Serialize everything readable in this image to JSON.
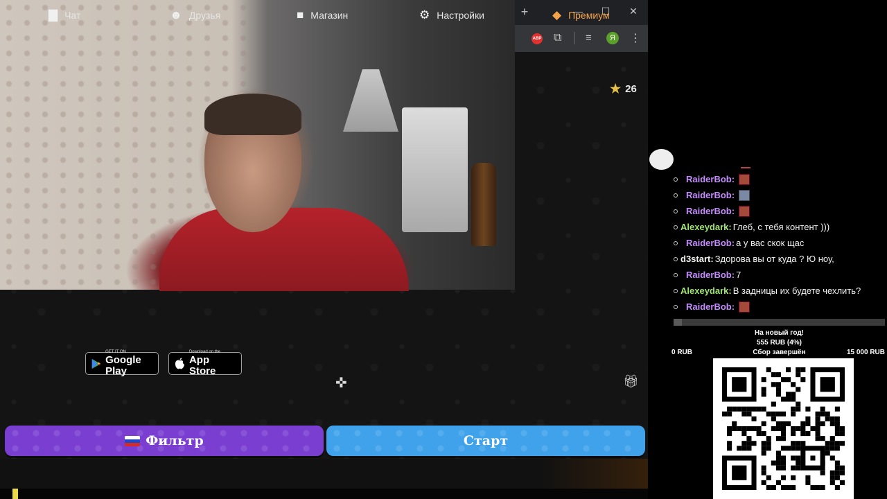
{
  "browser": {
    "new_tab": "+",
    "minimize": "—",
    "maximize": "☐",
    "close": "✕",
    "abp_badge": "ABP",
    "profile_letter": "Я"
  },
  "stream": {
    "stars_count": "26"
  },
  "stores": {
    "google_small": "GET IT ON",
    "google_big": "Google Play",
    "apple_small": "Download on the",
    "apple_big": "App Store"
  },
  "actions": {
    "filter_label": "Фильтр",
    "start_label": "Старт"
  },
  "nav": {
    "chat": "Чат",
    "friends": "Друзья",
    "shop": "Магазин",
    "settings": "Настройки",
    "premium": "Премиум"
  },
  "chat": {
    "messages": [
      {
        "user": "RaiderBob:",
        "text": "",
        "emote": "emote"
      },
      {
        "user": "RaiderBob:",
        "text": "",
        "emote": "satellite"
      },
      {
        "user": "RaiderBob:",
        "text": "",
        "emote": "emote"
      },
      {
        "user": "Alexeydark:",
        "text": "Глеб, с тебя контент )))",
        "emote": ""
      },
      {
        "user": "RaiderBob:",
        "text": "а у вас скок щас",
        "emote": ""
      },
      {
        "user": "d3start:",
        "text": "Здорова вы от куда ? Ю ноу,",
        "emote": ""
      },
      {
        "user": "RaiderBob:",
        "text": "7",
        "emote": ""
      },
      {
        "user": "Alexeydark:",
        "text": "В задницы их будете чехлить?",
        "emote": ""
      },
      {
        "user": "RaiderBob:",
        "text": "",
        "emote": "emote"
      }
    ]
  },
  "donation_goal": {
    "title": "На новый год!",
    "amount": "555 RUB (4%)",
    "progress": 0.04,
    "min": "0 RUB",
    "status": "Сбор завершён",
    "max": "15 000 RUB"
  },
  "colors": {
    "filter_button": "#7a3fd1",
    "start_button": "#3fa2ea",
    "premium": "#f5a44a",
    "username_purple": "#c68cff",
    "username_green": "#9fe870"
  }
}
